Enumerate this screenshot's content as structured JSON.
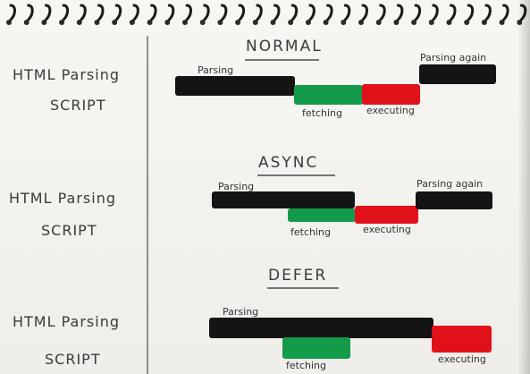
{
  "left_labels": [
    {
      "line1": "HTML Parsing",
      "line2": "SCRIPT"
    },
    {
      "line1": "HTML Parsing",
      "line2": "SCRIPT"
    },
    {
      "line1": "HTML Parsing",
      "line2": "SCRIPT"
    }
  ],
  "sections": [
    {
      "title": "NORMAL",
      "labels": {
        "parsing": "Parsing",
        "fetching": "fetching",
        "executing": "executing",
        "parsing_again": "Parsing again"
      }
    },
    {
      "title": "ASYNC",
      "labels": {
        "parsing": "Parsing",
        "fetching": "fetching",
        "executing": "executing",
        "parsing_again": "Parsing again"
      }
    },
    {
      "title": "DEFER",
      "labels": {
        "parsing": "Parsing",
        "fetching": "fetching",
        "executing": "executing"
      }
    }
  ],
  "colors": {
    "parsing": "#141414",
    "fetching": "#149a4b",
    "executing": "#e1111a"
  }
}
